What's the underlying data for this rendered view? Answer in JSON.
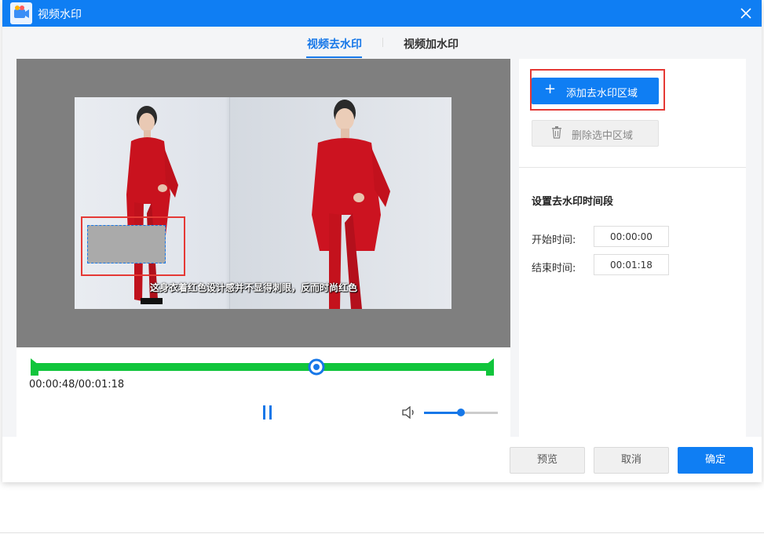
{
  "window": {
    "title": "视频水印"
  },
  "tabs": [
    {
      "label": "视频去水印",
      "active": true
    },
    {
      "label": "视频加水印",
      "active": false
    }
  ],
  "video": {
    "subtitle": "这身衣着红色设计感并不显得刺眼，反而时尚红色",
    "time_display": "00:00:48/00:01:18",
    "progress": 0.616,
    "volume": 0.5
  },
  "right_panel": {
    "add_button": "添加去水印区域",
    "delete_button": "删除选中区域",
    "section_title": "设置去水印时间段",
    "start_label": "开始时间:",
    "start_value": "00:00:00",
    "end_label": "结束时间:",
    "end_value": "00:01:18"
  },
  "footer": {
    "preview": "预览",
    "cancel": "取消",
    "ok": "确定"
  },
  "colors": {
    "primary": "#0f7ef3",
    "track": "#11c53c",
    "highlight": "#e53935"
  }
}
